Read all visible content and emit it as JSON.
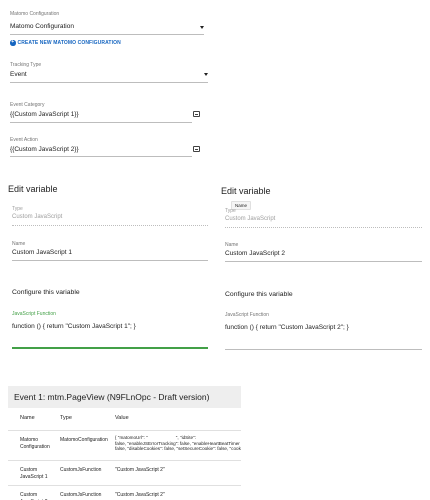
{
  "top_form": {
    "matomo_config": {
      "label": "Matomo Configuration",
      "value": "Matomo Configuration"
    },
    "create_link": "CREATE NEW MATOMO CONFIGURATION",
    "tracking_type": {
      "label": "Tracking Type",
      "value": "Event"
    },
    "event_category": {
      "label": "Event Category",
      "value": "{{Custom JavaScript 1}}"
    },
    "event_action": {
      "label": "Event Action",
      "value": "{{Custom JavaScript 2}}"
    }
  },
  "edit_left": {
    "title": "Edit variable",
    "type_label": "Type",
    "type_value": "Custom JavaScript",
    "name_label": "Name",
    "name_value": "Custom JavaScript 1",
    "section": "Configure this variable",
    "fn_label": "JavaScript Function",
    "fn_value": "function () { return \"Custom JavaScript 1\"; }"
  },
  "edit_right": {
    "title": "Edit variable",
    "tooltip": "Name",
    "type_label": "Type",
    "type_value": "Custom JavaScript",
    "name_label": "Name",
    "name_value": "Custom JavaScript 2",
    "section": "Configure this variable",
    "fn_label": "JavaScript Function",
    "fn_value": "function () { return \"Custom JavaScript 2\"; }"
  },
  "event_table": {
    "title": "Event 1: mtm.PageView (N9FLnOpc - Draft version)",
    "headers": [
      "Name",
      "Type",
      "Value"
    ],
    "rows": [
      {
        "name": "Matomo\nConfiguration",
        "type": "MatomoConfiguration",
        "value": "{ \"matomoUrl\": \"                      \", \"idSite\": \nfalse, \"enableJSErrorTracking\": false, \"enableHeartBeatTimer\nfalse, \"disableCookies\": false, \"setSecureCookie\": false, \"cookieDo"
      },
      {
        "name": "Custom\nJavaScript 1",
        "type": "CustomJsFunction",
        "value": "\"Custom JavaScript 2\""
      },
      {
        "name": "Custom\nJavaScript 2",
        "type": "CustomJsFunction",
        "value": "\"Custom JavaScript 2\""
      }
    ]
  }
}
